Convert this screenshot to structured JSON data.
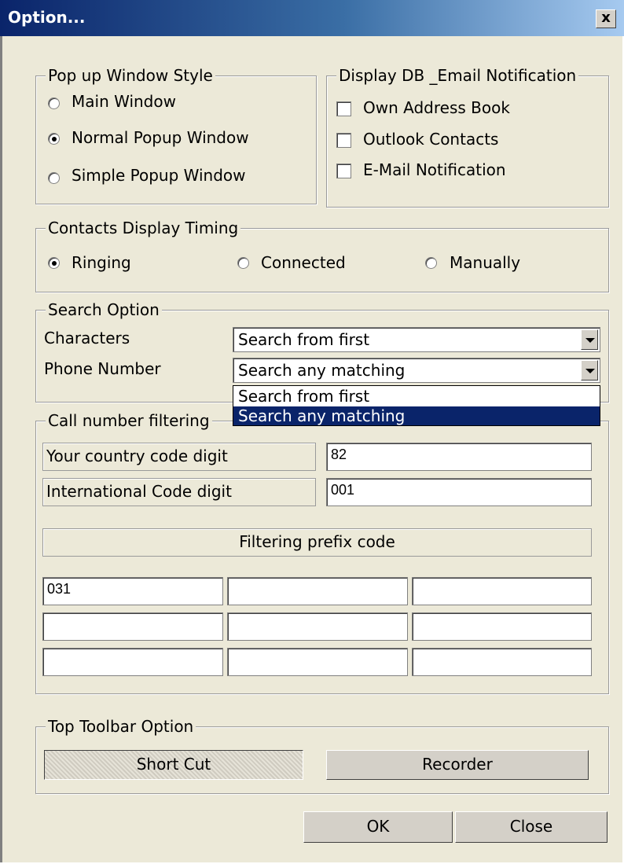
{
  "window": {
    "title": "Option...",
    "close_glyph": "x"
  },
  "popup_style": {
    "legend": "Pop up Window Style",
    "options": [
      {
        "label": "Main Window",
        "selected": false
      },
      {
        "label": "Normal Popup Window",
        "selected": true
      },
      {
        "label": "Simple Popup Window",
        "selected": false
      }
    ]
  },
  "display_db": {
    "legend": "Display DB _Email Notification",
    "options": [
      {
        "label": "Own Address Book",
        "checked": false
      },
      {
        "label": "Outlook Contacts",
        "checked": false
      },
      {
        "label": "E-Mail Notification",
        "checked": false
      }
    ]
  },
  "display_timing": {
    "legend": "Contacts Display Timing",
    "options": [
      {
        "label": "Ringing",
        "selected": true
      },
      {
        "label": "Connected",
        "selected": false
      },
      {
        "label": "Manually",
        "selected": false
      }
    ]
  },
  "search": {
    "legend": "Search Option",
    "characters_label": "Characters",
    "characters_value": "Search from first",
    "phone_label": "Phone Number",
    "phone_value": "Search any matching",
    "dropdown_options": [
      "Search from first",
      "Search any matching"
    ],
    "dropdown_selected_index": 1
  },
  "filtering": {
    "legend": "Call number filtering",
    "country_code_label": "Your country code digit",
    "country_code_value": "82",
    "intl_code_label": "International Code digit",
    "intl_code_value": "001",
    "prefix_header": "Filtering prefix code",
    "prefix_codes": [
      "031",
      "",
      "",
      "",
      "",
      "",
      "",
      "",
      ""
    ]
  },
  "toolbar": {
    "legend": "Top Toolbar Option",
    "shortcut_label": "Short Cut",
    "recorder_label": "Recorder"
  },
  "buttons": {
    "ok": "OK",
    "close": "Close"
  },
  "colors": {
    "titlebar_start": "#0a246a",
    "titlebar_end": "#a6caf0",
    "selection": "#0a246a",
    "dialog_bg": "#ece9d8"
  }
}
